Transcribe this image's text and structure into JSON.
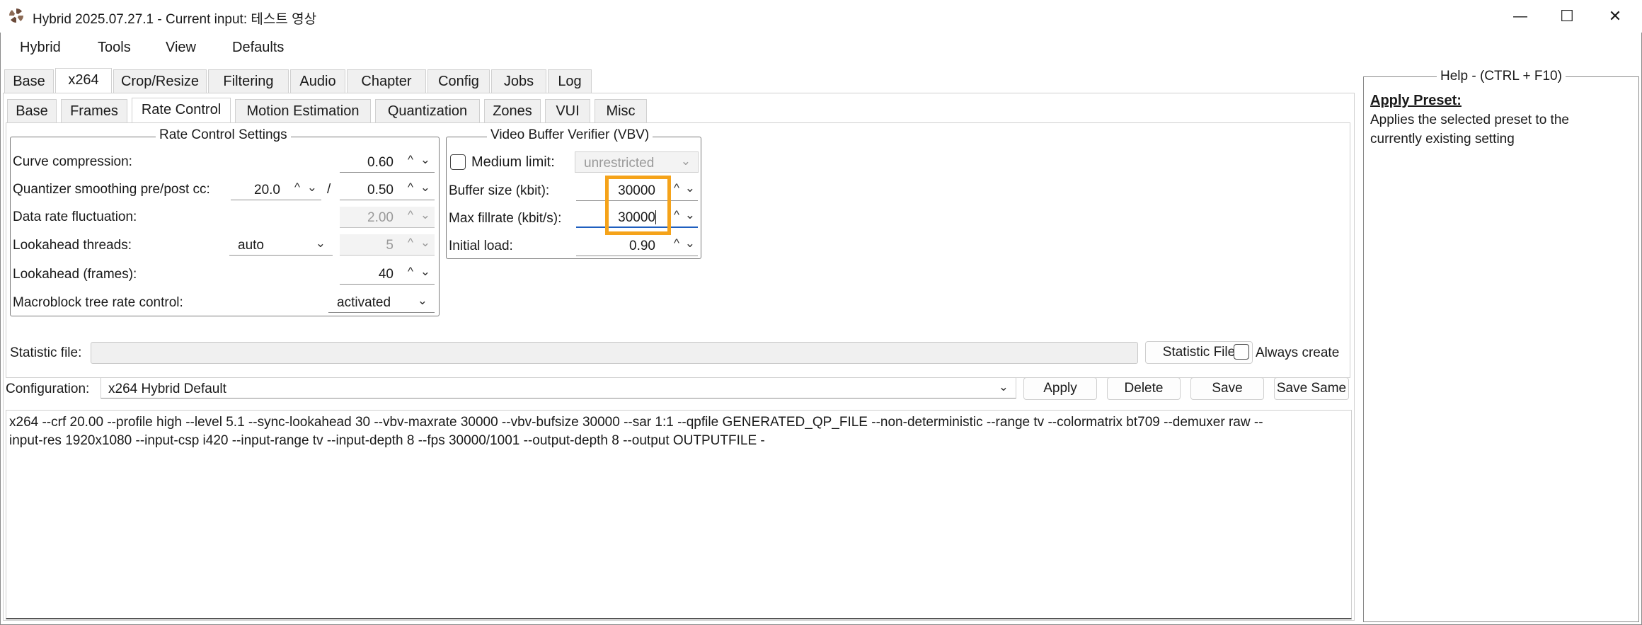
{
  "window": {
    "title": "Hybrid 2025.07.27.1 - Current input: 테스트 영상",
    "controls": {
      "minimize": "—",
      "maximize": "☐",
      "close": "✕"
    }
  },
  "menubar": [
    "Hybrid",
    "Tools",
    "View",
    "Defaults"
  ],
  "main_tabs": [
    "Base",
    "x264",
    "Crop/Resize",
    "Filtering",
    "Audio",
    "Chapter",
    "Config",
    "Jobs",
    "Log"
  ],
  "active_main_tab": "x264",
  "sub_tabs": [
    "Base",
    "Frames",
    "Rate Control",
    "Motion Estimation",
    "Quantization",
    "Zones",
    "VUI",
    "Misc"
  ],
  "active_sub_tab": "Rate Control",
  "rate_control": {
    "legend": "Rate Control Settings",
    "curve_compression": {
      "label": "Curve compression:",
      "value": "0.60"
    },
    "qsmooth": {
      "label": "Quantizer smoothing pre/post cc:",
      "pre": "20.0",
      "sep": "/",
      "post": "0.50"
    },
    "data_rate_fluct": {
      "label": "Data rate fluctuation:",
      "value": "2.00"
    },
    "lookahead_threads": {
      "label": "Lookahead threads:",
      "mode": "auto",
      "value": "5"
    },
    "lookahead_frames": {
      "label": "Lookahead (frames):",
      "value": "40"
    },
    "mbtree": {
      "label": "Macroblock tree rate control:",
      "value": "activated"
    }
  },
  "vbv": {
    "legend": "Video Buffer Verifier (VBV)",
    "medium_limit": {
      "label": "Medium limit:",
      "value": "unrestricted",
      "checked": false
    },
    "buffer_size": {
      "label": "Buffer size (kbit):",
      "value": "30000"
    },
    "max_fillrate": {
      "label": "Max fillrate (kbit/s):",
      "value": "30000"
    },
    "initial_load": {
      "label": "Initial load:",
      "value": "0.90"
    }
  },
  "statistic": {
    "label": "Statistic file:",
    "value": "",
    "button": "Statistic File",
    "always_create": "Always create"
  },
  "configuration": {
    "label": "Configuration:",
    "value": "x264 Hybrid Default",
    "apply": "Apply",
    "delete": "Delete",
    "save": "Save",
    "save_same": "Save Same"
  },
  "command": {
    "line1": "x264 --crf 20.00 --profile high --level 5.1 --sync-lookahead 30 --vbv-maxrate 30000 --vbv-bufsize 30000 --sar 1:1 --qpfile GENERATED_QP_FILE --non-deterministic --range tv --colormatrix bt709 --demuxer raw --",
    "line2": "input-res 1920x1080 --input-csp i420 --input-range tv --input-depth 8 --fps 30000/1001 --output-depth 8 --output OUTPUTFILE -"
  },
  "help": {
    "legend": "Help - (CTRL + F10)",
    "heading": "Apply Preset:",
    "line1": "Applies the selected preset to the",
    "line2": "currently existing setting"
  },
  "icons": {
    "spin_up": "^",
    "spin_down": "⌄",
    "dropdown": "⌄"
  },
  "colors": {
    "highlight": "#f5a31a",
    "focus": "#1f5fbf"
  }
}
